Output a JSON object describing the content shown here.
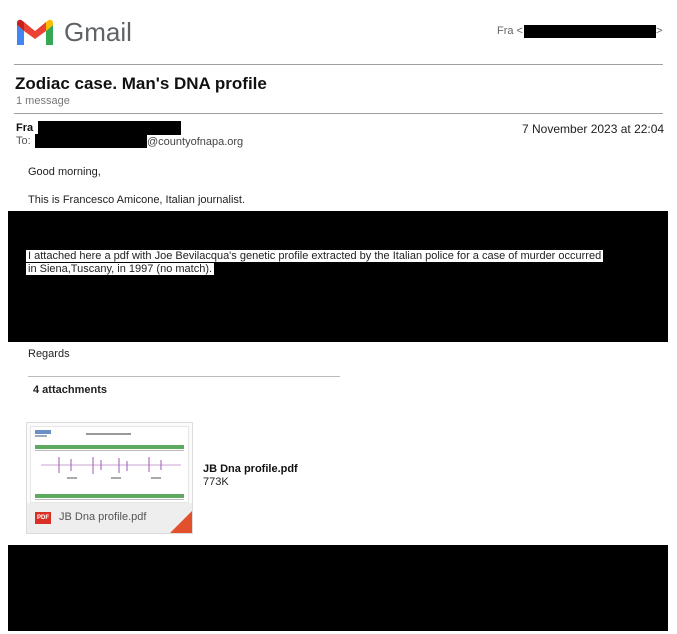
{
  "header": {
    "logo_text": "Gmail",
    "account_prefix": "Fra <",
    "account_suffix": ">",
    "colors": {
      "red": "#EA4335",
      "blue": "#4285F4",
      "green": "#34A853",
      "yellow": "#FBBC04"
    }
  },
  "thread": {
    "subject": "Zodiac case. Man's DNA profile",
    "count": "1 message"
  },
  "message": {
    "from_name": "Fra",
    "to_label": "To:",
    "to_domain": "@countyofnapa.org",
    "date": "7 November 2023 at 22:04",
    "greeting": "Good morning,",
    "intro": "This is Francesco Amicone, Italian journalist.",
    "attached_line1": "I attached here a pdf with Joe Bevilacqua's genetic profile extracted by the Italian police for a case of murder occurred",
    "attached_line2": "in Siena,Tuscany, in 1997 (no match).",
    "regards": "Regards"
  },
  "attachments": {
    "heading": "4 attachments",
    "items": [
      {
        "name": "JB Dna profile.pdf",
        "size": "773K",
        "footer_name": "JB Dna profile.pdf",
        "badge": "PDF",
        "icon": "pdf-icon"
      }
    ]
  }
}
